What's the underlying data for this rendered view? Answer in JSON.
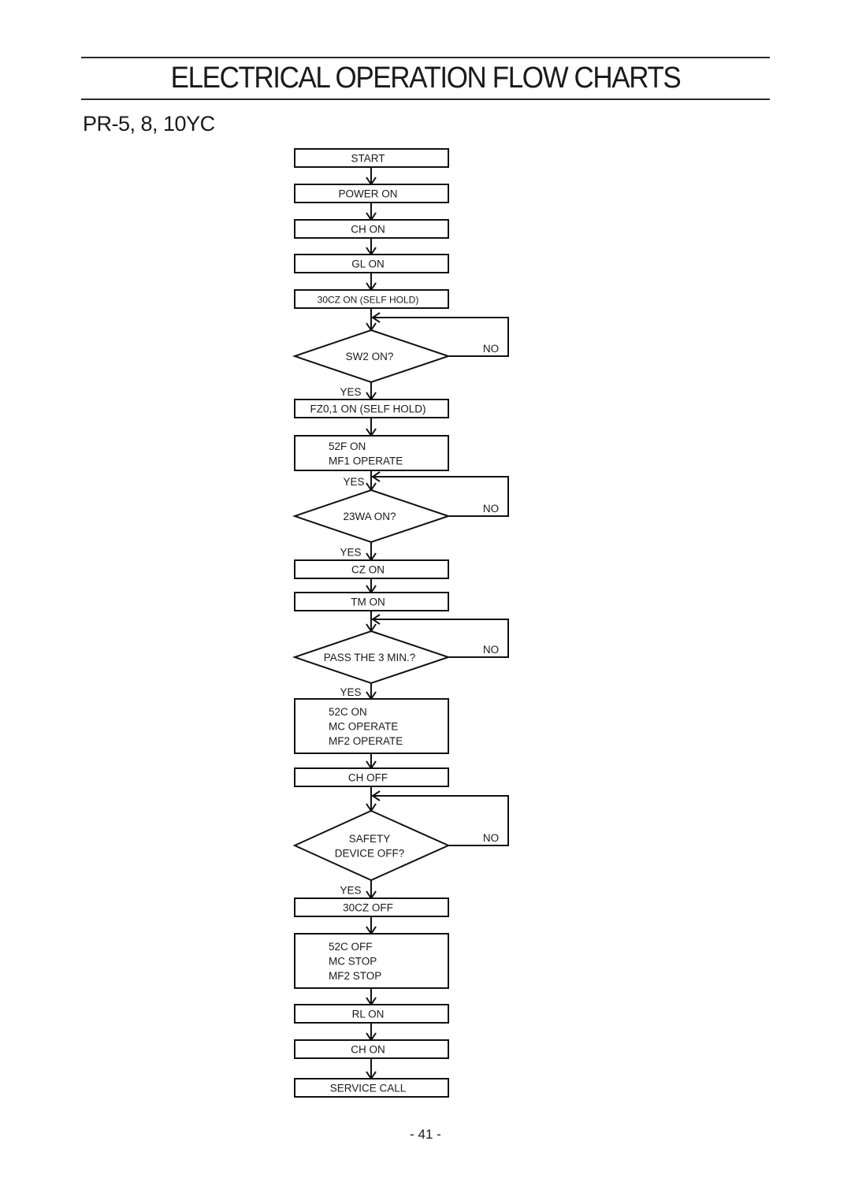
{
  "header": {
    "title": "ELECTRICAL OPERATION FLOW CHARTS",
    "model": "PR-5, 8, 10YC"
  },
  "flowchart": {
    "nodes": [
      {
        "id": "start",
        "type": "process",
        "lines": [
          "START"
        ]
      },
      {
        "id": "power-on",
        "type": "process",
        "lines": [
          "POWER  ON"
        ]
      },
      {
        "id": "ch-on",
        "type": "process",
        "lines": [
          "CH   ON"
        ]
      },
      {
        "id": "gl-on",
        "type": "process",
        "lines": [
          "GL    ON"
        ]
      },
      {
        "id": "30cz-on",
        "type": "process",
        "lines": [
          "30CZ ON (SELF  HOLD)"
        ],
        "small": true
      },
      {
        "id": "sw2-on",
        "type": "decision",
        "lines": [
          "SW2    ON?"
        ],
        "yes": "YES",
        "no": "NO"
      },
      {
        "id": "fz01-on",
        "type": "process",
        "lines": [
          "FZ0,1  ON (SELF  HOLD)"
        ]
      },
      {
        "id": "52f-on",
        "type": "process",
        "lines": [
          "52F  ON",
          "MF1  OPERATE"
        ],
        "align": "left"
      },
      {
        "id": "23wa-on",
        "type": "decision",
        "lines": [
          "23WA  ON?"
        ],
        "yes": "YES",
        "no": "NO",
        "yes_in": "YES"
      },
      {
        "id": "cz-on",
        "type": "process",
        "lines": [
          "CZ    ON"
        ]
      },
      {
        "id": "tm-on",
        "type": "process",
        "lines": [
          "TM   ON"
        ]
      },
      {
        "id": "pass-3min",
        "type": "decision",
        "lines": [
          "PASS  THE  3  MIN.?"
        ],
        "yes": "YES",
        "no": "NO"
      },
      {
        "id": "52c-on",
        "type": "process",
        "lines": [
          "52C  ON",
          "MC   OPERATE",
          "MF2  OPERATE"
        ],
        "align": "left"
      },
      {
        "id": "ch-off",
        "type": "process",
        "lines": [
          "CH    OFF"
        ]
      },
      {
        "id": "safety-off",
        "type": "decision",
        "lines": [
          "SAFETY",
          "DEVICE  OFF?"
        ],
        "yes": "YES",
        "no": "NO"
      },
      {
        "id": "30cz-off",
        "type": "process",
        "lines": [
          "30CZ    OFF"
        ]
      },
      {
        "id": "52c-off",
        "type": "process",
        "lines": [
          "52C    OFF",
          "MC    STOP",
          "MF2    STOP"
        ],
        "align": "left"
      },
      {
        "id": "rl-on",
        "type": "process",
        "lines": [
          "RL    ON"
        ]
      },
      {
        "id": "ch-on-2",
        "type": "process",
        "lines": [
          "CH   ON"
        ]
      },
      {
        "id": "service-call",
        "type": "process",
        "lines": [
          "SERVICE  CALL"
        ]
      }
    ]
  },
  "footer": {
    "page_number": "- 41 -"
  }
}
